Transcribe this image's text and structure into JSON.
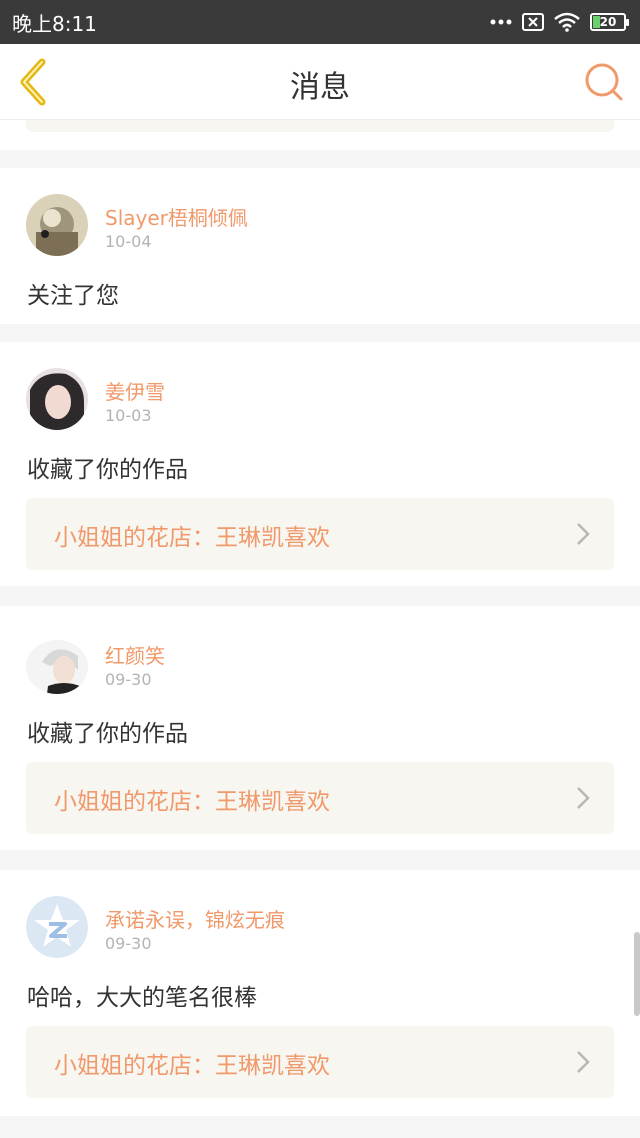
{
  "status_bar": {
    "time": "晚上8:11",
    "battery": "20"
  },
  "header": {
    "title": "消息"
  },
  "colors": {
    "accent": "#f0996a",
    "back_icon": "#e6b814",
    "work_bg": "#f7f6f1"
  },
  "messages": [
    {
      "username": "Slayer梧桐倾佩",
      "date": "10-04",
      "text": "关注了您"
    },
    {
      "username": "姜伊雪",
      "date": "10-03",
      "text": "收藏了你的作品",
      "work": "小姐姐的花店：王琳凯喜欢"
    },
    {
      "username": "红颜笑",
      "date": "09-30",
      "text": "收藏了你的作品",
      "work": "小姐姐的花店：王琳凯喜欢"
    },
    {
      "username": "承诺永误，锦炫无痕",
      "date": "09-30",
      "text": "哈哈，大大的笔名很棒",
      "work": "小姐姐的花店：王琳凯喜欢"
    }
  ]
}
